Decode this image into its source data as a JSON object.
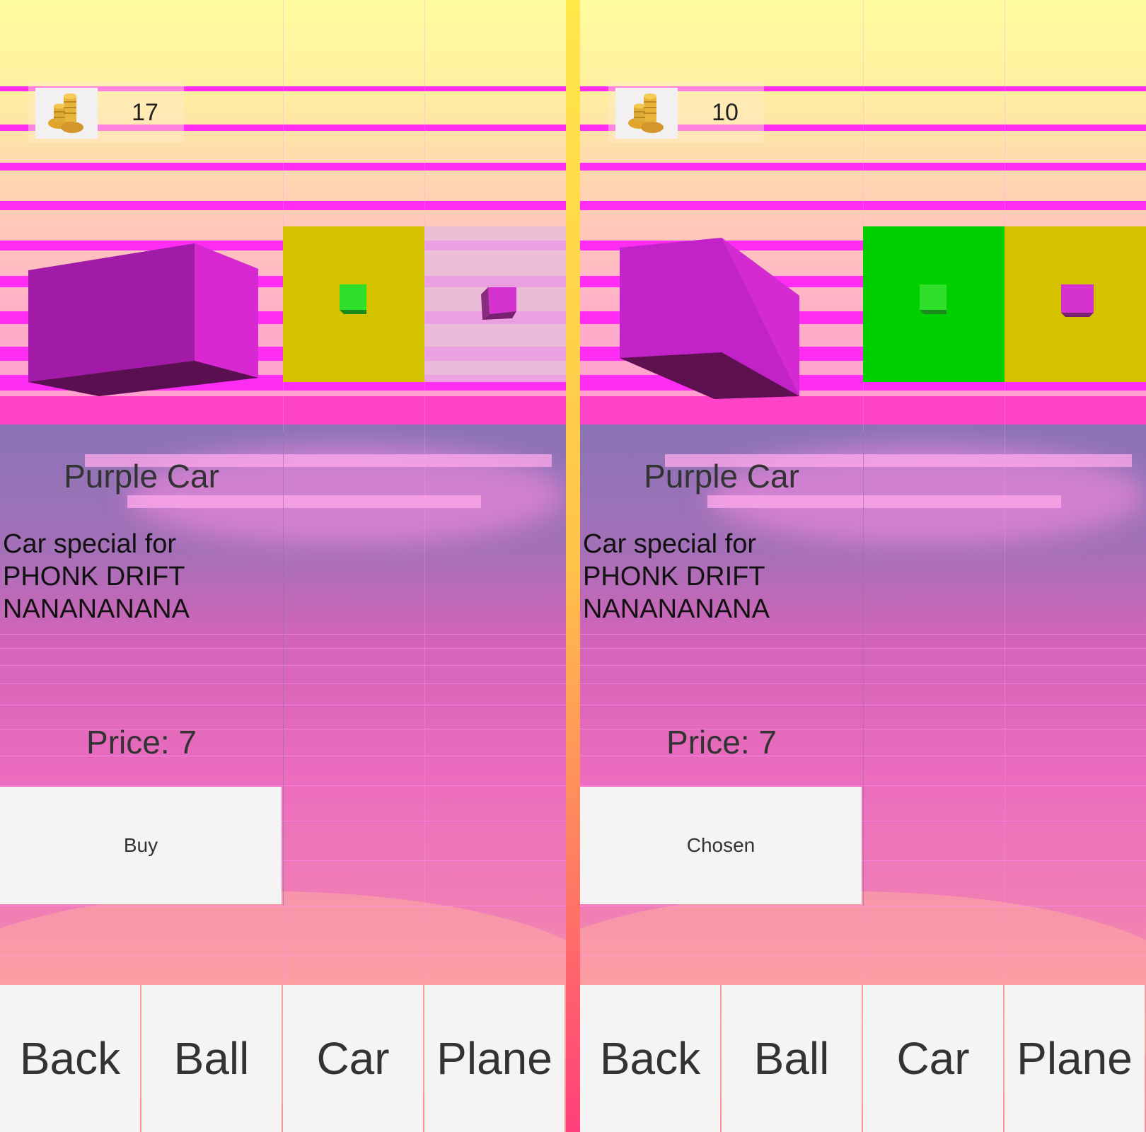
{
  "panels": [
    {
      "coins": "17",
      "product": {
        "title": "Purple Car",
        "description": "Car special for\nPHONK DRIFT\nNANANANANA",
        "price": "Price: 7",
        "action_label": "Buy"
      },
      "cards": [
        {
          "state": "selected",
          "color": "#d4c200",
          "cube_color": "#2ee02a"
        },
        {
          "state": "locked",
          "color": "rgba(230,190,220,0.8)",
          "cube_color": "#d632d0"
        }
      ],
      "tabs": [
        "Back",
        "Ball",
        "Car",
        "Plane"
      ]
    },
    {
      "coins": "10",
      "product": {
        "title": "Purple Car",
        "description": "Car special for\nPHONK DRIFT\nNANANANANA",
        "price": "Price: 7",
        "action_label": "Chosen"
      },
      "cards": [
        {
          "state": "owned",
          "color": "#00d000",
          "cube_color": "#2ee02a"
        },
        {
          "state": "selected",
          "color": "#d4c200",
          "cube_color": "#d632d0"
        }
      ],
      "tabs": [
        "Back",
        "Ball",
        "Car",
        "Plane"
      ]
    }
  ],
  "icons": {
    "coins": "gold-coins-icon"
  },
  "colors": {
    "stripe": "#ff2cf4",
    "car": "#c223c8",
    "divider": "#ffd34a"
  }
}
